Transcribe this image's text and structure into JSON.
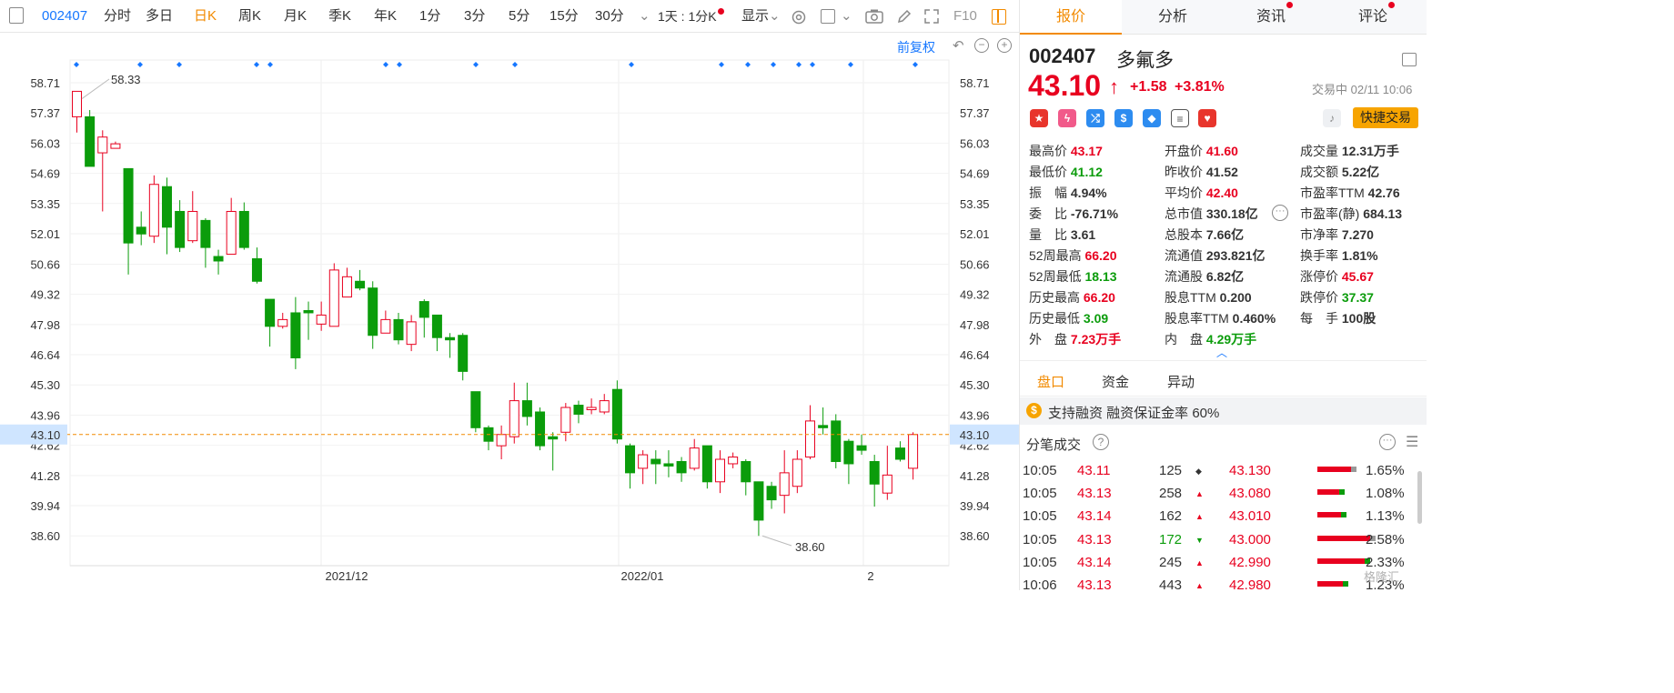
{
  "toolbar": {
    "code": "002407",
    "items": [
      "分时",
      "多日",
      "日K",
      "周K",
      "月K",
      "季K",
      "年K",
      "1分",
      "3分",
      "5分",
      "15分",
      "30分"
    ],
    "active_item": "日K",
    "minute_select": "1天 : 1分K",
    "display_label": "显示",
    "f10_label": "F10",
    "restore_label": "前复权"
  },
  "chart_data": {
    "type": "candlestick",
    "y_ticks": [
      "58.71",
      "57.37",
      "56.03",
      "54.69",
      "53.35",
      "52.01",
      "50.66",
      "49.32",
      "47.98",
      "46.64",
      "45.30",
      "43.96",
      "42.62",
      "41.28",
      "39.94",
      "38.60"
    ],
    "ylim": [
      37.5,
      59.5
    ],
    "x_labels": [
      "2021/12",
      "2022/01",
      "2"
    ],
    "current_price": "43.10",
    "high_annotation": "58.33",
    "low_annotation": "38.60",
    "candles": [
      [
        57.2,
        58.33,
        56.9,
        58.0,
        56.5
      ],
      [
        57.2,
        55.0,
        55.8,
        57.5,
        55.0
      ],
      [
        55.6,
        56.3,
        56.0,
        56.6,
        53.0
      ],
      [
        55.8,
        56.0,
        56.0,
        56.1,
        55.8
      ],
      [
        54.9,
        51.6,
        54.9,
        51.6,
        50.2
      ],
      [
        52.3,
        52.0,
        52.4,
        53.0,
        51.5
      ],
      [
        51.9,
        54.2,
        54.3,
        54.6,
        51.6
      ],
      [
        54.1,
        52.3,
        54.4,
        54.5,
        51.1
      ],
      [
        53.0,
        51.4,
        53.1,
        53.5,
        51.2
      ],
      [
        51.7,
        53.0,
        53.4,
        53.9,
        51.6
      ],
      [
        52.6,
        51.4,
        52.6,
        52.7,
        50.5
      ],
      [
        51.0,
        50.8,
        51.0,
        51.3,
        50.2
      ],
      [
        51.1,
        53.0,
        53.3,
        53.6,
        51.2
      ],
      [
        53.0,
        51.4,
        53.2,
        53.4,
        51.3
      ],
      [
        50.9,
        49.9,
        50.9,
        51.4,
        49.8
      ],
      [
        49.1,
        47.9,
        49.1,
        49.1,
        47.0
      ],
      [
        47.9,
        48.2,
        48.3,
        48.5,
        47.8
      ],
      [
        48.5,
        46.5,
        48.6,
        49.2,
        46.0
      ],
      [
        48.6,
        48.5,
        48.7,
        49.0,
        47.3
      ],
      [
        48.0,
        48.4,
        48.5,
        49.0,
        47.7
      ],
      [
        47.9,
        50.4,
        50.5,
        50.7,
        47.9
      ],
      [
        49.2,
        50.1,
        50.3,
        50.5,
        49.2
      ],
      [
        49.9,
        49.6,
        50.0,
        50.4,
        49.5
      ],
      [
        49.6,
        47.5,
        49.6,
        49.9,
        46.9
      ],
      [
        47.6,
        48.2,
        48.4,
        48.6,
        47.6
      ],
      [
        48.2,
        47.3,
        48.2,
        48.5,
        47.1
      ],
      [
        47.1,
        48.1,
        48.3,
        48.4,
        46.8
      ],
      [
        49.0,
        48.3,
        49.1,
        49.1,
        47.4
      ],
      [
        48.4,
        47.4,
        48.4,
        48.4,
        46.8
      ],
      [
        47.4,
        47.3,
        47.6,
        47.6,
        46.5
      ],
      [
        47.5,
        45.9,
        47.6,
        47.6,
        45.5
      ],
      [
        45.0,
        43.4,
        45.0,
        45.0,
        43.2
      ],
      [
        43.4,
        42.8,
        43.5,
        43.5,
        42.4
      ],
      [
        42.6,
        43.1,
        43.4,
        43.5,
        42.0
      ],
      [
        43.0,
        44.6,
        45.2,
        45.4,
        42.7
      ],
      [
        44.6,
        43.9,
        45.3,
        45.4,
        43.5
      ],
      [
        44.1,
        42.6,
        44.2,
        44.3,
        42.4
      ],
      [
        43.0,
        42.9,
        43.1,
        43.2,
        41.5
      ],
      [
        43.2,
        44.3,
        44.4,
        44.5,
        42.8
      ],
      [
        44.4,
        44.0,
        44.6,
        44.6,
        43.6
      ],
      [
        44.2,
        44.3,
        44.3,
        44.7,
        44.0
      ],
      [
        44.1,
        44.6,
        44.7,
        44.9,
        44.0
      ],
      [
        45.1,
        42.9,
        45.2,
        45.5,
        42.7
      ],
      [
        42.6,
        41.4,
        42.7,
        42.7,
        40.7
      ],
      [
        41.6,
        42.2,
        42.4,
        42.4,
        40.9
      ],
      [
        42.0,
        41.8,
        42.2,
        42.4,
        40.9
      ],
      [
        41.8,
        41.7,
        41.9,
        42.4,
        41.2
      ],
      [
        41.9,
        41.4,
        42.0,
        42.1,
        41.0
      ],
      [
        41.6,
        42.5,
        42.6,
        42.9,
        41.5
      ],
      [
        42.6,
        41.0,
        42.6,
        42.6,
        40.7
      ],
      [
        41.0,
        42.0,
        42.1,
        42.4,
        40.5
      ],
      [
        41.8,
        42.1,
        42.1,
        42.3,
        41.6
      ],
      [
        41.9,
        41.0,
        41.9,
        42.0,
        40.4
      ],
      [
        41.0,
        39.3,
        41.0,
        41.0,
        38.6
      ],
      [
        40.8,
        40.2,
        40.9,
        41.0,
        39.8
      ],
      [
        40.4,
        41.4,
        41.6,
        42.4,
        39.6
      ],
      [
        40.8,
        42.0,
        42.2,
        42.4,
        40.5
      ],
      [
        42.1,
        43.7,
        43.9,
        44.4,
        42.0
      ],
      [
        43.5,
        43.4,
        43.6,
        44.3,
        43.1
      ],
      [
        43.7,
        41.9,
        43.8,
        44.0,
        41.6
      ],
      [
        42.8,
        41.8,
        42.9,
        42.9,
        40.9
      ],
      [
        42.6,
        42.4,
        42.7,
        43.1,
        42.2
      ],
      [
        41.9,
        40.9,
        42.0,
        42.2,
        39.9
      ],
      [
        40.5,
        41.3,
        42.4,
        42.6,
        40.2
      ],
      [
        42.5,
        42.0,
        42.6,
        42.8,
        41.9
      ],
      [
        41.6,
        43.1,
        43.17,
        43.2,
        41.1
      ]
    ]
  },
  "quote": {
    "code": "002407",
    "name": "多氟多",
    "price": "43.10",
    "arrow": "↑",
    "change": "+1.58",
    "change_pct": "+3.81%",
    "status_time": "交易中 02/11 10:06",
    "trade_button": "快捷交易",
    "stats": [
      [
        {
          "label": "最高价",
          "value": "43.17",
          "color": "up"
        },
        {
          "label": "开盘价",
          "value": "41.60",
          "color": "up"
        },
        {
          "label": "成交量",
          "value": "12.31万手",
          "color": "none"
        }
      ],
      [
        {
          "label": "最低价",
          "value": "41.12",
          "color": "dn"
        },
        {
          "label": "昨收价",
          "value": "41.52",
          "color": "none"
        },
        {
          "label": "成交额",
          "value": "5.22亿",
          "color": "none"
        }
      ],
      [
        {
          "label": "振　幅",
          "value": "4.94%",
          "color": "none"
        },
        {
          "label": "平均价",
          "value": "42.40",
          "color": "up"
        },
        {
          "label": "市盈率TTM",
          "value": "42.76",
          "color": "none"
        }
      ],
      [
        {
          "label": "委　比",
          "value": "-76.71%",
          "color": "none"
        },
        {
          "label": "总市值",
          "value": "330.18亿",
          "color": "none"
        },
        {
          "label": "市盈率(静)",
          "value": "684.13",
          "color": "none"
        }
      ],
      [
        {
          "label": "量　比",
          "value": "3.61",
          "color": "none"
        },
        {
          "label": "总股本",
          "value": "7.66亿",
          "color": "none"
        },
        {
          "label": "市净率",
          "value": "7.270",
          "color": "none"
        }
      ],
      [
        {
          "label": "52周最高",
          "value": "66.20",
          "color": "up"
        },
        {
          "label": "流通值",
          "value": "293.821亿",
          "color": "none"
        },
        {
          "label": "换手率",
          "value": "1.81%",
          "color": "none"
        }
      ],
      [
        {
          "label": "52周最低",
          "value": "18.13",
          "color": "dn"
        },
        {
          "label": "流通股",
          "value": "6.82亿",
          "color": "none"
        },
        {
          "label": "涨停价",
          "value": "45.67",
          "color": "up"
        }
      ],
      [
        {
          "label": "历史最高",
          "value": "66.20",
          "color": "up"
        },
        {
          "label": "股息TTM",
          "value": "0.200",
          "color": "none"
        },
        {
          "label": "跌停价",
          "value": "37.37",
          "color": "dn"
        }
      ],
      [
        {
          "label": "历史最低",
          "value": "3.09",
          "color": "dn"
        },
        {
          "label": "股息率TTM",
          "value": "0.460%",
          "color": "none"
        },
        {
          "label": "每　手",
          "value": "100股",
          "color": "none"
        }
      ],
      [
        {
          "label": "外　盘",
          "value": "7.23万手",
          "color": "up"
        },
        {
          "label": "内　盘",
          "value": "4.29万手",
          "color": "dn"
        }
      ]
    ]
  },
  "panel_tabs": [
    "报价",
    "分析",
    "资讯",
    "评论"
  ],
  "sub_tabs": [
    "盘口",
    "资金",
    "异动"
  ],
  "margin_text": "支持融资 融资保证金率 60%",
  "ticks_title": "分笔成交",
  "ticks": [
    {
      "time": "10:05",
      "price": "43.11",
      "vol": "125",
      "dir": "flat",
      "depth": "43.130",
      "pct": "1.65%",
      "bar": 0.62
    },
    {
      "time": "10:05",
      "price": "43.13",
      "vol": "258",
      "dir": "up",
      "depth": "43.080",
      "pct": "1.08%",
      "bar": 0.4
    },
    {
      "time": "10:05",
      "price": "43.14",
      "vol": "162",
      "dir": "up",
      "depth": "43.010",
      "pct": "1.13%",
      "bar": 0.44
    },
    {
      "time": "10:05",
      "price": "43.13",
      "vol": "172",
      "dir": "dn",
      "depth": "43.000",
      "pct": "2.58%",
      "bar": 0.96
    },
    {
      "time": "10:05",
      "price": "43.14",
      "vol": "245",
      "dir": "up",
      "depth": "42.990",
      "pct": "2.33%",
      "bar": 0.86
    },
    {
      "time": "10:06",
      "price": "43.13",
      "vol": "443",
      "dir": "up",
      "depth": "42.980",
      "pct": "1.23%",
      "bar": 0.46
    }
  ],
  "watermark": "格隆汇",
  "colors": {
    "up": "#e8001f",
    "down": "#0b9c0b",
    "accent": "#f28a00",
    "link": "#1677ff"
  }
}
